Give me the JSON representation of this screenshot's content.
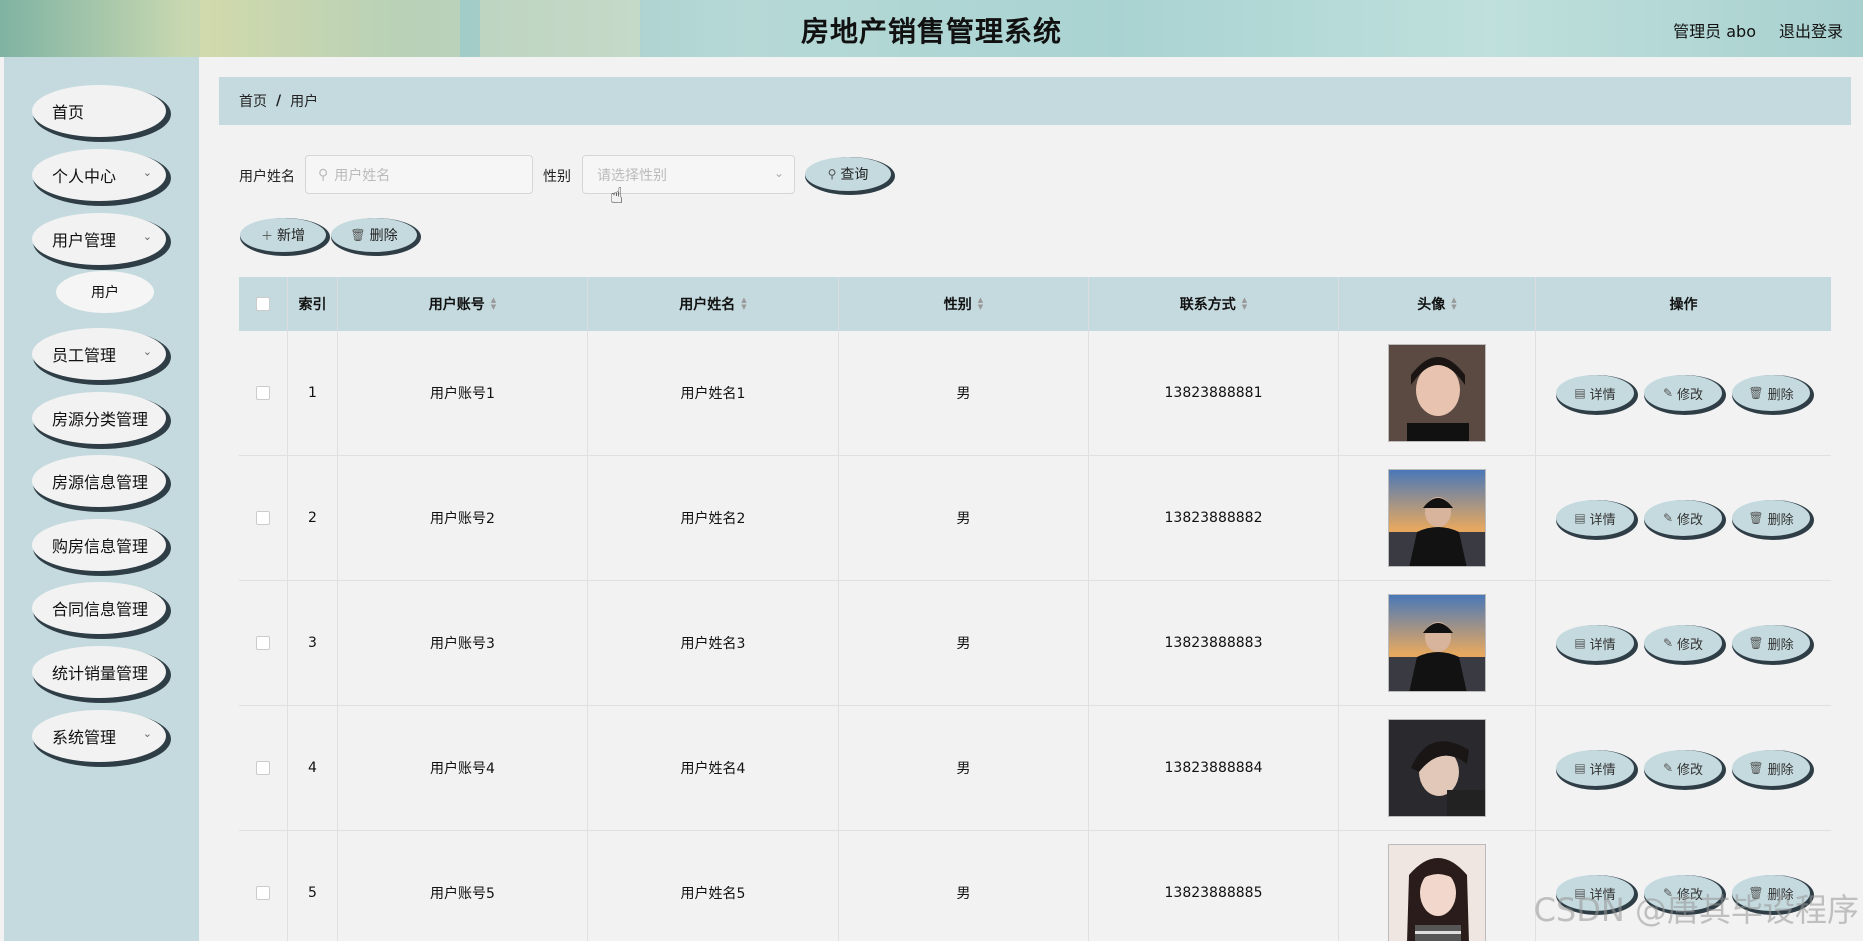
{
  "header": {
    "title": "房地产销售管理系统",
    "user": "管理员 abo",
    "logout": "退出登录"
  },
  "sidebar": {
    "items": [
      {
        "label": "首页",
        "has_sub": false
      },
      {
        "label": "个人中心",
        "has_sub": true
      },
      {
        "label": "用户管理",
        "has_sub": true
      },
      {
        "label": "员工管理",
        "has_sub": true
      },
      {
        "label": "房源分类管理",
        "has_sub": false
      },
      {
        "label": "房源信息管理",
        "has_sub": false
      },
      {
        "label": "购房信息管理",
        "has_sub": false
      },
      {
        "label": "合同信息管理",
        "has_sub": false
      },
      {
        "label": "统计销量管理",
        "has_sub": false
      },
      {
        "label": "系统管理",
        "has_sub": true
      }
    ],
    "submenu": {
      "label": "用户"
    }
  },
  "breadcrumb": {
    "home": "首页",
    "sep": "/",
    "current": "用户"
  },
  "search": {
    "name_label": "用户姓名",
    "name_placeholder": "用户姓名",
    "gender_label": "性别",
    "gender_placeholder": "请选择性别",
    "query_label": "查询"
  },
  "toolbar": {
    "add_label": "新增",
    "delete_label": "删除"
  },
  "table": {
    "columns": [
      "索引",
      "用户账号",
      "用户姓名",
      "性别",
      "联系方式",
      "头像",
      "操作"
    ],
    "actions": {
      "detail": "详情",
      "edit": "修改",
      "delete": "删除"
    },
    "rows": [
      {
        "index": "1",
        "account": "用户账号1",
        "name": "用户姓名1",
        "gender": "男",
        "phone": "13823888881"
      },
      {
        "index": "2",
        "account": "用户账号2",
        "name": "用户姓名2",
        "gender": "男",
        "phone": "13823888882"
      },
      {
        "index": "3",
        "account": "用户账号3",
        "name": "用户姓名3",
        "gender": "男",
        "phone": "13823888883"
      },
      {
        "index": "4",
        "account": "用户账号4",
        "name": "用户姓名4",
        "gender": "男",
        "phone": "13823888884"
      },
      {
        "index": "5",
        "account": "用户账号5",
        "name": "用户姓名5",
        "gender": "男",
        "phone": "13823888885"
      }
    ]
  },
  "watermark": "CSDN @唐其毕设程序",
  "colors": {
    "accent": "#c5dade",
    "shadow": "#2f3e46",
    "background": "#f2f2f2"
  }
}
